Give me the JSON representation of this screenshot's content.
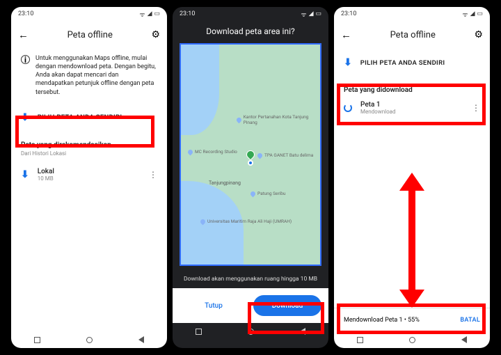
{
  "status": {
    "time": "23:10",
    "bat_icon": "▭",
    "signal": "◢",
    "wifi": "ᯤ"
  },
  "p1": {
    "title": "Peta offline",
    "info": "Untuk menggunakan Maps offline, mulai dengan mendownload peta. Dengan begitu, Anda akan dapat mencari dan mendapatkan petunjuk offline dengan peta tersebut.",
    "pick": "PILIH PETA ANDA SENDIRI",
    "rec_title": "Peta yang direkomendasikan",
    "rec_sub": "Dari Histori Lokasi",
    "item_title": "Lokal",
    "item_sub": "10 MB"
  },
  "p2": {
    "title": "Download peta area ini?",
    "poi1": "Kantor Pertanahan Kota Tanjung Pinang",
    "poi2": "MC Recording Studio",
    "poi3": "TPA GANET Batu delima",
    "poi4": "Patung Seribu",
    "poi5": "Universitas Maritim Raja Ali Haji (UMRAH)",
    "loc_center": "Tanjungpinang",
    "note": "Download akan menggunakan ruang hingga 10 MB",
    "tutup": "Tutup",
    "download": "Download"
  },
  "p3": {
    "title": "Peta offline",
    "pick": "PILIH PETA ANDA SENDIRI",
    "section": "Peta yang didownload",
    "item_title": "Peta 1",
    "item_sub": "Mendownload",
    "dl_status": "Mendownload Peta 1 • 55%",
    "batal": "BATAL"
  }
}
